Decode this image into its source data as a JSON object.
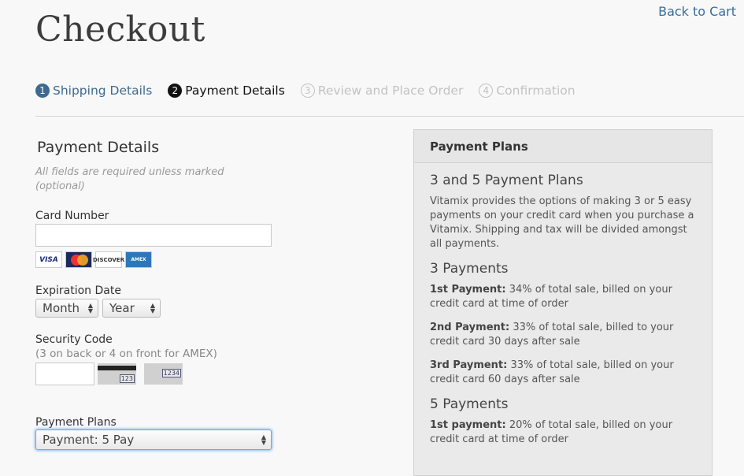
{
  "header": {
    "title": "Checkout",
    "back_link": "Back to Cart"
  },
  "steps": [
    {
      "num": "1",
      "label": "Shipping Details"
    },
    {
      "num": "2",
      "label": "Payment Details"
    },
    {
      "num": "3",
      "label": "Review and Place Order"
    },
    {
      "num": "4",
      "label": "Confirmation"
    }
  ],
  "form": {
    "heading": "Payment Details",
    "note": "All fields are required unless marked (optional)",
    "card_number_label": "Card Number",
    "card_number_value": "",
    "card_logos": [
      "VISA",
      "MasterCard",
      "DISCOVER",
      "AMERICAN EXPRESS"
    ],
    "expiration_label": "Expiration Date",
    "month_value": "Month",
    "year_value": "Year",
    "security_label": "Security Code",
    "security_sub": "(3 on back or 4 on front for AMEX)",
    "security_value": "",
    "cvv_back_code": "123",
    "cvv_front_code": "1234",
    "plans_label": "Payment Plans",
    "plans_value": "Payment: 5 Pay"
  },
  "panel": {
    "title": "Payment Plans",
    "h_intro": "3 and 5 Payment Plans",
    "intro": "Vitamix provides the options of making 3 or 5 easy payments on your credit card when you purchase a Vitamix. Shipping and tax will be divided amongst all payments.",
    "h_three": "3 Payments",
    "three": [
      {
        "bold": "1st Payment:",
        "text": " 34% of total sale, billed on your credit card at time of order"
      },
      {
        "bold": "2nd Payment:",
        "text": " 33% of total sale, billed to your credit card 30 days after sale"
      },
      {
        "bold": "3rd Payment:",
        "text": " 33% of total sale, billed on your credit card 60 days after sale"
      }
    ],
    "h_five": "5 Payments",
    "five": [
      {
        "bold": "1st payment:",
        "text": " 20% of total sale, billed on your credit card at time of order"
      }
    ]
  },
  "colors": {
    "link": "#3a6d9a",
    "step_done": "#3e6a8f",
    "step_future": "#c2c2c2",
    "focus": "#8fb8ea"
  }
}
